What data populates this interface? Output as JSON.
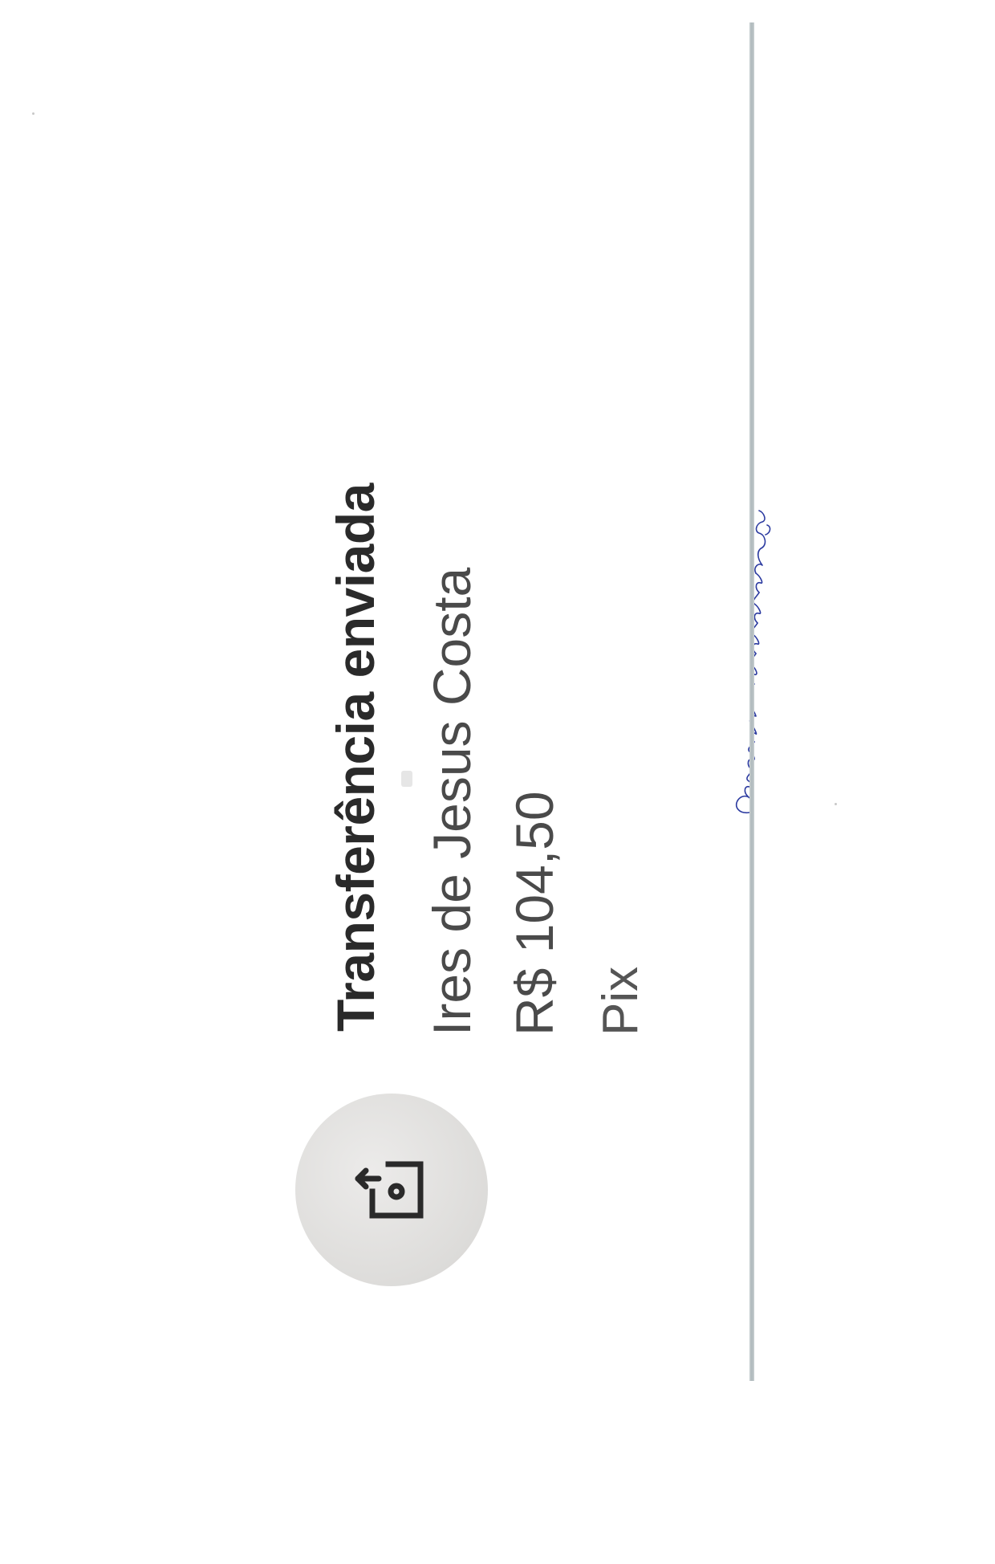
{
  "transaction": {
    "title": "Transferência enviada",
    "recipient": "Ires de Jesus Costa",
    "amount": "R$ 104,50",
    "method": "Pix"
  },
  "annotation": {
    "handwritten_note": "Compras mainingue"
  },
  "icons": {
    "transfer": "transfer-out-icon",
    "signature": "handwritten-signature"
  },
  "colors": {
    "text_dark": "#2a2a2a",
    "text_gray": "#4a4a4a",
    "avatar_bg": "#dddcda",
    "divider": "#aeb8bb",
    "ink": "#2b3aa0"
  }
}
